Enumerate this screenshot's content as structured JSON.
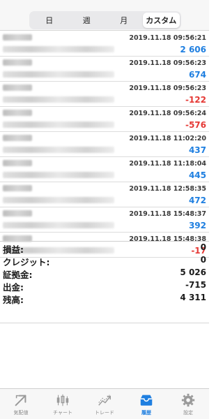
{
  "period_tabs": [
    "日",
    "週",
    "月",
    "カスタム"
  ],
  "history": [
    {
      "time": "2019.11.18 09:56:21",
      "value": "2 606",
      "sign": "pos"
    },
    {
      "time": "2019.11.18 09:56:23",
      "value": "674",
      "sign": "pos"
    },
    {
      "time": "2019.11.18 09:56:23",
      "value": "-122",
      "sign": "neg"
    },
    {
      "time": "2019.11.18 09:56:24",
      "value": "-576",
      "sign": "neg"
    },
    {
      "time": "2019.11.18 11:02:20",
      "value": "437",
      "sign": "pos"
    },
    {
      "time": "2019.11.18 11:18:04",
      "value": "445",
      "sign": "pos"
    },
    {
      "time": "2019.11.18 12:58:35",
      "value": "472",
      "sign": "pos"
    },
    {
      "time": "2019.11.18 15:48:37",
      "value": "392",
      "sign": "pos"
    },
    {
      "time": "2019.11.18 15:48:38",
      "value": "-17",
      "sign": "neg"
    }
  ],
  "summary": [
    {
      "label": "損益:",
      "value": "0"
    },
    {
      "label": "クレジット:",
      "value": "0"
    },
    {
      "label": "証拠金:",
      "value": "5 026"
    },
    {
      "label": "出金:",
      "value": "-715"
    },
    {
      "label": "残高:",
      "value": "4 311"
    }
  ],
  "bottom_tabs": [
    {
      "label": "気配値",
      "icon": "quotes-icon"
    },
    {
      "label": "チャート",
      "icon": "chart-icon"
    },
    {
      "label": "トレード",
      "icon": "trade-icon"
    },
    {
      "label": "履歴",
      "icon": "history-icon"
    },
    {
      "label": "設定",
      "icon": "settings-icon"
    }
  ],
  "colors": {
    "positive": "#1f7fe0",
    "negative": "#e53935",
    "active_tab": "#1f7fe0"
  }
}
